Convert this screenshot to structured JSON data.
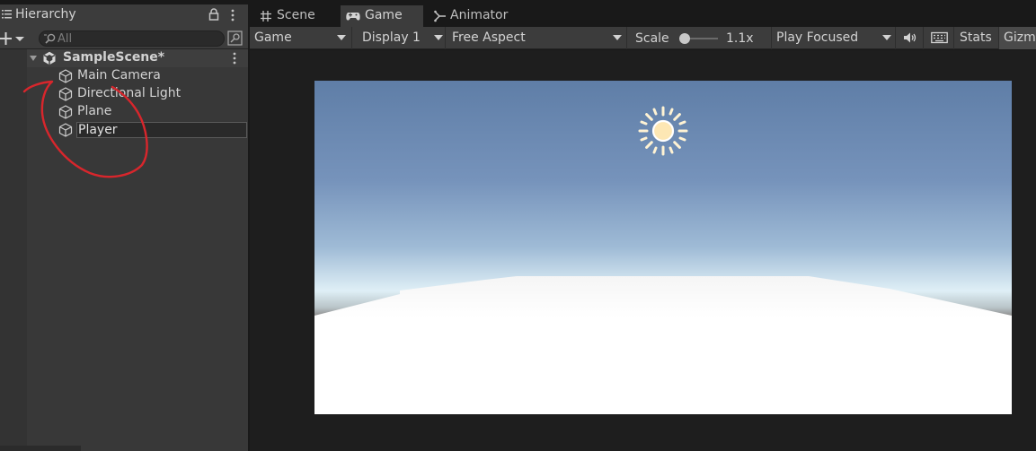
{
  "hierarchy": {
    "tab_title": "Hierarchy",
    "search_placeholder": "All",
    "scene": {
      "name": "SampleScene*",
      "objects": [
        "Main Camera",
        "Directional Light",
        "Plane"
      ],
      "renaming_value": "Player"
    },
    "annotation_color": "#d8262c"
  },
  "game": {
    "tabs": [
      "Scene",
      "Game",
      "Animator"
    ],
    "active_tab": "Game",
    "toolbar": {
      "view_mode": "Game",
      "display": "Display 1",
      "aspect": "Free Aspect",
      "scale_label": "Scale",
      "scale_value": "1.1x",
      "play_mode": "Play Focused",
      "stats": "Stats",
      "gizmos": "Gizmos"
    }
  },
  "colors": {
    "panel_bg": "#383838",
    "toolbar_bg": "#3c3c3c",
    "window_bg": "#191919",
    "sky_top": "#5f7ea7",
    "horizon": "#dfeff6",
    "ground_plane": "#ffffff"
  }
}
